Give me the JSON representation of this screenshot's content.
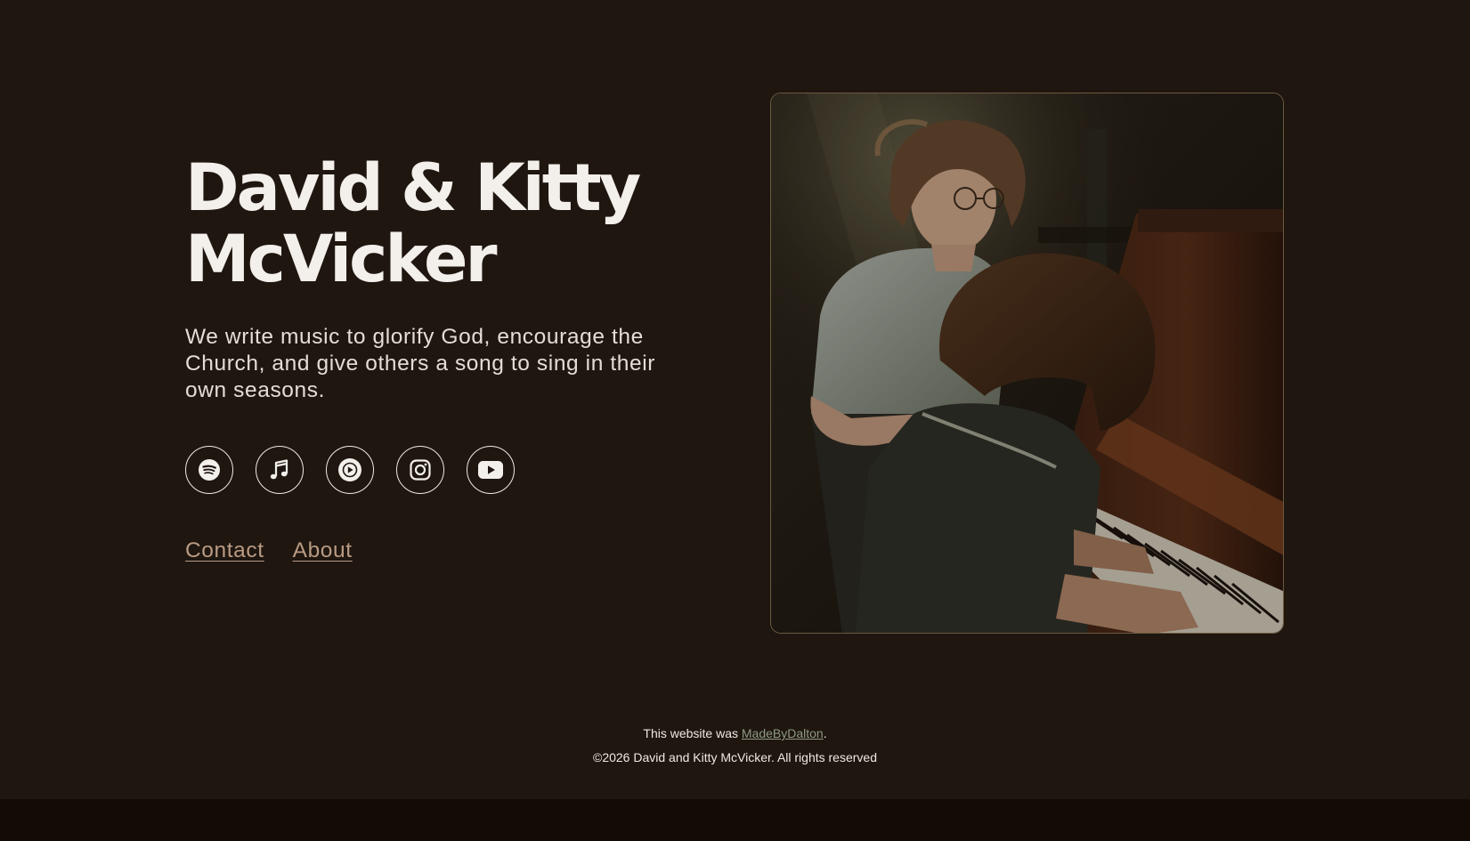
{
  "hero": {
    "title_line1": "David & Kitty",
    "title_line2": "McVicker",
    "tagline": "We write music to glorify God, encourage the Church, and give others a song to sing in their own seasons."
  },
  "socials": [
    {
      "icon": "spotify-icon"
    },
    {
      "icon": "apple-music-icon"
    },
    {
      "icon": "youtube-music-icon"
    },
    {
      "icon": "instagram-icon"
    },
    {
      "icon": "youtube-icon"
    }
  ],
  "nav": {
    "contact": "Contact",
    "about": "About"
  },
  "footer": {
    "made_by_prefix": "This website was ",
    "made_by_link": "MadeByDalton",
    "made_by_suffix": ".",
    "copyright": "©2026 David and Kitty McVicker. All rights reserved"
  },
  "colors": {
    "background": "#1f1610",
    "text": "#efe9e3",
    "link": "#b99b83",
    "footer_link": "#8d9a83",
    "bottom_bar": "#120b06"
  }
}
